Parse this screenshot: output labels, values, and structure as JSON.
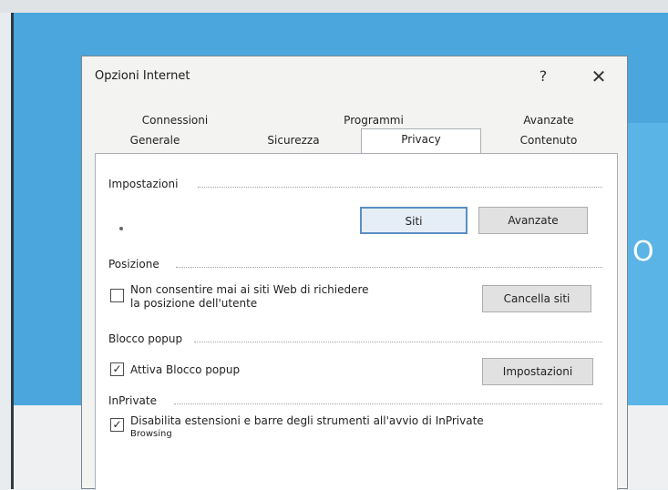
{
  "dialog": {
    "title": "Opzioni Internet",
    "help_label": "?",
    "close_label": "✕"
  },
  "tabs": {
    "row1": [
      "Connessioni",
      "Programmi",
      "Avanzate"
    ],
    "row2": [
      "Generale",
      "Sicurezza",
      "Privacy",
      "Contenuto"
    ],
    "active": "Privacy"
  },
  "settings": {
    "label": "Impostazioni",
    "sites_button": "Siti",
    "advanced_button": "Avanzate"
  },
  "location": {
    "label": "Posizione",
    "checkbox_line1": "Non consentire mai ai siti Web di richiedere",
    "checkbox_line2": "la posizione dell'utente",
    "checked": false,
    "clear_sites_button": "Cancella siti"
  },
  "popup_blocker": {
    "label": "Blocco popup",
    "checkbox_label": "Attiva Blocco popup",
    "checked": true,
    "settings_button": "Impostazioni"
  },
  "inprivate": {
    "label": "InPrivate",
    "checkbox_line1": "Disabilita estensioni e barre degli strumenti all'avvio di InPrivate",
    "checkbox_line2": "Browsing",
    "checked": true
  },
  "background": {
    "glyph": "O"
  }
}
